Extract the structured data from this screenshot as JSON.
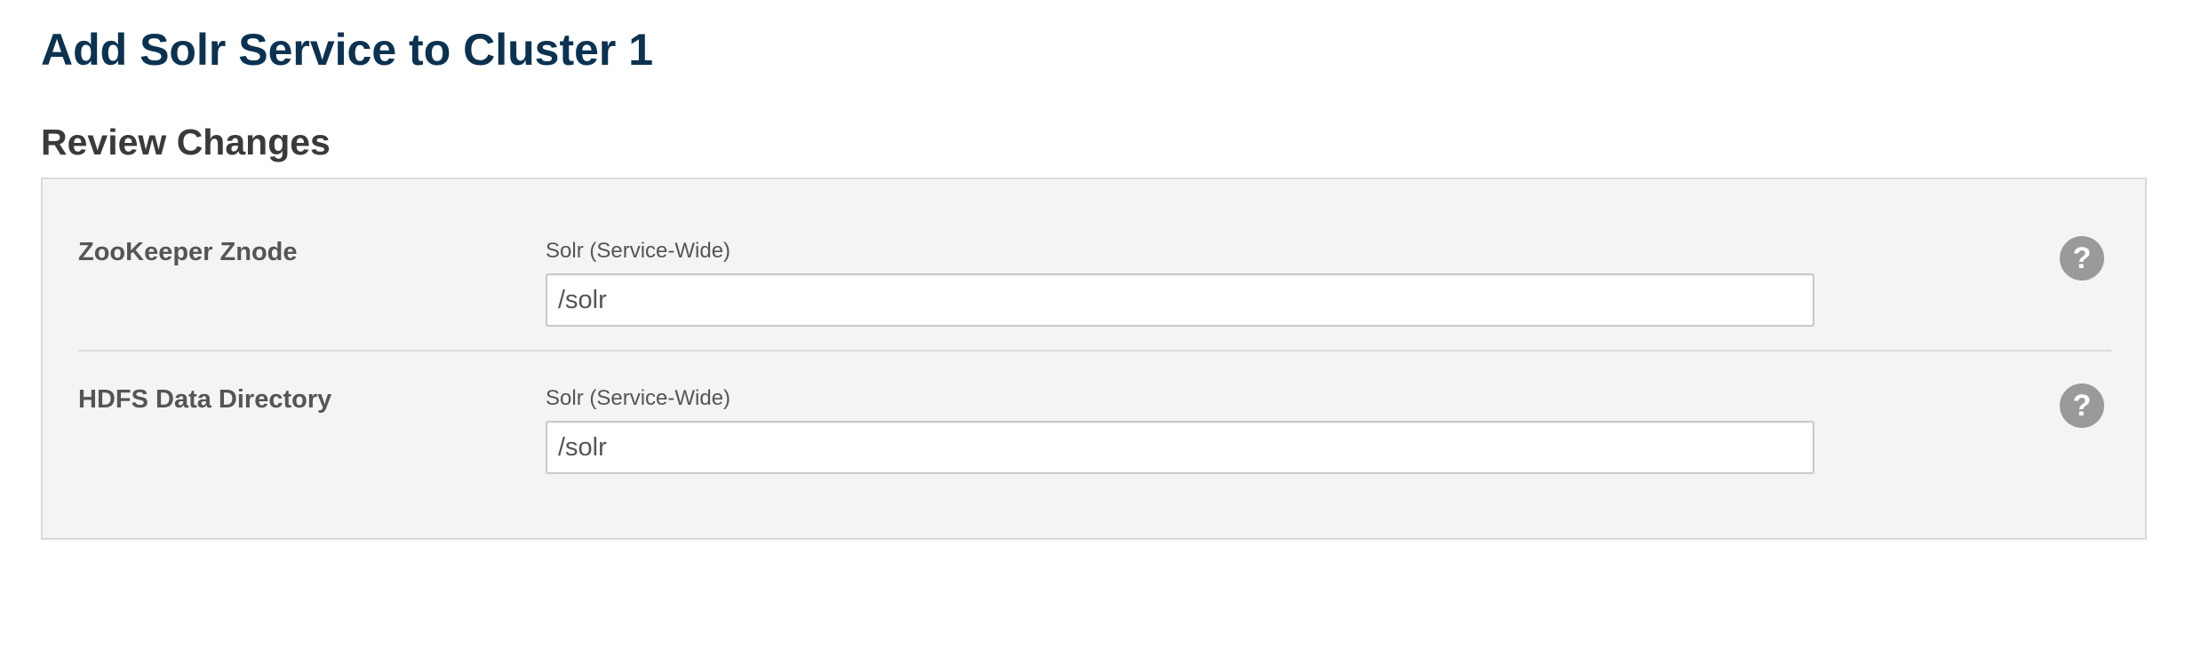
{
  "header": {
    "title": "Add Solr Service to Cluster 1"
  },
  "review": {
    "heading": "Review Changes",
    "rows": [
      {
        "name": "ZooKeeper Znode",
        "scope": "Solr (Service-Wide)",
        "value": "/solr",
        "help_icon": "question-circle-icon",
        "help_glyph": "?"
      },
      {
        "name": "HDFS Data Directory",
        "scope": "Solr (Service-Wide)",
        "value": "/solr",
        "help_icon": "question-circle-icon",
        "help_glyph": "?"
      }
    ]
  },
  "colors": {
    "title": "#0b3250",
    "panel_background": "#f4f4f4",
    "help_icon": "#9a9a9a"
  }
}
